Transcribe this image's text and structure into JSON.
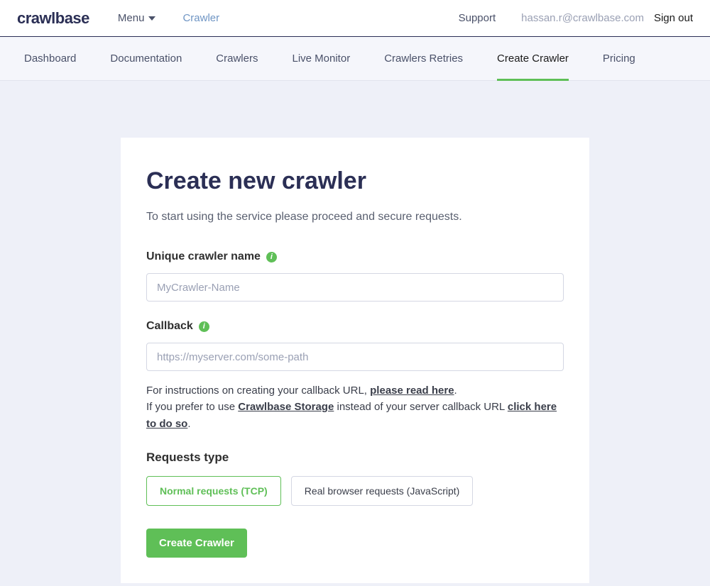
{
  "topbar": {
    "logo": "crawlbase",
    "menu_label": "Menu",
    "crawler_link": "Crawler",
    "support": "Support",
    "user_email": "hassan.r@crawlbase.com",
    "signout": "Sign out"
  },
  "nav": {
    "items": [
      "Dashboard",
      "Documentation",
      "Crawlers",
      "Live Monitor",
      "Crawlers Retries",
      "Create Crawler",
      "Pricing"
    ],
    "active_index": 5
  },
  "card": {
    "title": "Create new crawler",
    "subtitle": "To start using the service please proceed and secure requests.",
    "name_label": "Unique crawler name",
    "name_placeholder": "MyCrawler-Name",
    "callback_label": "Callback",
    "callback_placeholder": "https://myserver.com/some-path",
    "help": {
      "line1_prefix": "For instructions on creating your callback URL, ",
      "line1_link": "please read here",
      "line2_prefix": "If you prefer to use ",
      "line2_strong": "Crawlbase Storage",
      "line2_mid": " instead of your server callback URL ",
      "line2_link": "click here to do so"
    },
    "requests_title": "Requests type",
    "request_options": [
      "Normal requests (TCP)",
      "Real browser requests (JavaScript)"
    ],
    "selected_option": 0,
    "submit_label": "Create Crawler"
  }
}
